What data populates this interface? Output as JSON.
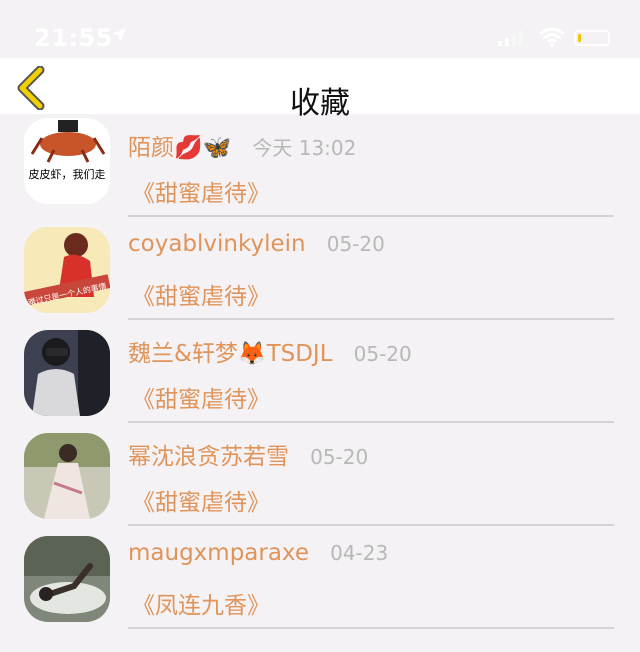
{
  "status": {
    "time": "21:55"
  },
  "nav": {
    "title": "收藏"
  },
  "items": [
    {
      "name": "陌颜💋🦋",
      "time": "今天 13:02",
      "book": "《甜蜜虐待》",
      "avatar_caption": "皮皮虾，我们走"
    },
    {
      "name": "coyablvinkylein",
      "time": "05-20",
      "book": "《甜蜜虐待》",
      "avatar_caption": "难过只是一个人的事情"
    },
    {
      "name": "魏兰&轩梦🦊TSDJL",
      "time": "05-20",
      "book": "《甜蜜虐待》"
    },
    {
      "name": "幂沈浪贪苏若雪",
      "time": "05-20",
      "book": "《甜蜜虐待》"
    },
    {
      "name": "maugxmparaxe",
      "time": "04-23",
      "book": "《凤连九香》"
    }
  ],
  "colors": {
    "accent": "#e0945a",
    "back_arrow": "#f0d000"
  }
}
